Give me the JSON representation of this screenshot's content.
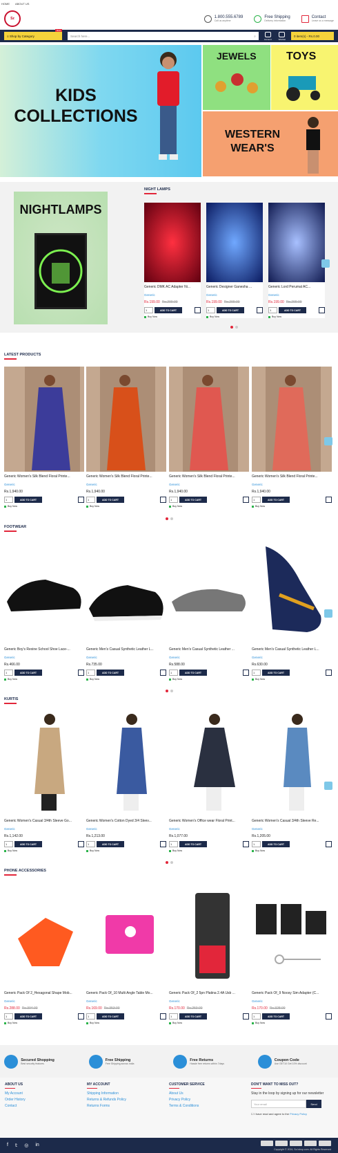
{
  "topbar": {
    "home": "HOME",
    "about": "ABOUT US"
  },
  "header": {
    "logo_text": "Sz",
    "phone": "1.800.555.6789",
    "phone_sub": "Call us anytime",
    "shipping": "Free Shipping",
    "shipping_sub": "Delivery information",
    "contact": "Contact",
    "contact_sub": "Leave us a message"
  },
  "nav": {
    "category": "Shop by Category",
    "new_tag": "New",
    "search_placeholder": "Search here...",
    "account": "Account",
    "wishlist": "Wishlist",
    "cart": "0 item(s) - Rs.0.00"
  },
  "hero": {
    "kids": "KIDS COLLECTIONS",
    "jewels": "JEWELS",
    "toys": "TOYS",
    "western": "WESTERN WEAR'S"
  },
  "nightlamps": {
    "banner": "NIGHTLAMPS",
    "title": "NIGHT LAMPS",
    "products": [
      {
        "name": "Generic DMK AC Adapter Ni...",
        "cat": "Generic",
        "price": "Rs.199.00",
        "old": "Rs.299.00"
      },
      {
        "name": "Generic Designer Ganesha ...",
        "cat": "Generic",
        "price": "Rs.199.00",
        "old": "Rs.299.00"
      },
      {
        "name": "Generic Lord Perumal AC...",
        "cat": "Generic",
        "price": "Rs.199.00",
        "old": "Rs.299.00"
      }
    ]
  },
  "common": {
    "qty": "1",
    "add": "ADD TO CART",
    "buy": "Buy Now"
  },
  "latest": {
    "title": "LATEST PRODUCTS",
    "products": [
      {
        "name": "Generic Women's Silk Blend Floral Printe...",
        "cat": "Generic",
        "price": "Rs.1,940.00"
      },
      {
        "name": "Generic Women's Silk Blend Floral Printe...",
        "cat": "Generic",
        "price": "Rs.1,940.00"
      },
      {
        "name": "Generic Women's Silk Blend Floral Printe...",
        "cat": "Generic",
        "price": "Rs.1,940.00"
      },
      {
        "name": "Generic Women's Silk Blend Floral Printe...",
        "cat": "Generic",
        "price": "Rs.1,940.00"
      }
    ]
  },
  "footwear": {
    "title": "FOOTWEAR",
    "products": [
      {
        "name": "Generic Boy's Rexine School Shoe Lace-...",
        "cat": "Generic",
        "price": "Rs.466.00"
      },
      {
        "name": "Generic Men's Casual Synthetic Leather L...",
        "cat": "Generic",
        "price": "Rs.735.00"
      },
      {
        "name": "Generic Men's Casual Synthetic Leather ...",
        "cat": "Generic",
        "price": "Rs.588.00"
      },
      {
        "name": "Generic Men's Casual Synthetic Leather L...",
        "cat": "Generic",
        "price": "Rs.630.00"
      }
    ]
  },
  "kurtis": {
    "title": "KURTIS",
    "products": [
      {
        "name": "Generic Women's Casual 3/4th Sleeve Go...",
        "cat": "Generic",
        "price": "Rs.1,142.00"
      },
      {
        "name": "Generic Women's Cotton Dyed 3/4 Sleev...",
        "cat": "Generic",
        "price": "Rs.1,213.00"
      },
      {
        "name": "Generic Women's Office wear Floral Print...",
        "cat": "Generic",
        "price": "Rs.1,077.00"
      },
      {
        "name": "Generic Women's Casual 3/4th Sleeve Re...",
        "cat": "Generic",
        "price": "Rs.1,205.00"
      }
    ]
  },
  "phone": {
    "title": "PHONE ACCESSORIES",
    "products": [
      {
        "name": "Generic Pack Of 2_Hexagonal Shape Mob...",
        "cat": "Generic",
        "price": "Rs.288.00",
        "old": "Rs.394.00"
      },
      {
        "name": "Generic Pack Of_10 Multi Angle Table Mo...",
        "cat": "Generic",
        "price": "Rs.169.00",
        "old": "Rs.353.00"
      },
      {
        "name": "Generic Pack Of_2 5pn Platina 2.4A Usb ...",
        "cat": "Generic",
        "price": "Rs.170.00",
        "old": "Rs.259.00"
      },
      {
        "name": "Generic Pack Of_9 Noosy Sim Adapter (C...",
        "cat": "Generic",
        "price": "Rs.170.00",
        "old": "Rs.328.00"
      }
    ]
  },
  "features": [
    {
      "t": "Secured Shopping",
      "s": "Best security features"
    },
    {
      "t": "Free Shipping",
      "s": "Free Shipping across India"
    },
    {
      "t": "Free Returns",
      "s": "Hassle free returns within 7days"
    },
    {
      "t": "Coupon Code",
      "s": "Use GET10 Get 10% discount"
    }
  ],
  "footer": {
    "about": {
      "title": "ABOUT US",
      "links": [
        "My Account",
        "Order History",
        "Contact"
      ]
    },
    "account": {
      "title": "MY ACCOUNT",
      "links": [
        "Shipping Information",
        "Returns & Refunds Policy",
        "Returns Forms"
      ]
    },
    "service": {
      "title": "CUSTOMER SERVICE",
      "links": [
        "About Us",
        "Privacy Policy",
        "Terms & Conditions"
      ]
    },
    "newsletter": {
      "title": "DON'T WANT TO MISS OUT?",
      "text": "Stay in the loop by signing up for our newsletter",
      "placeholder": "Your email",
      "send": "Send",
      "agree": "I have read and agree to the",
      "policy": "Privacy Policy"
    }
  },
  "bottom": {
    "copyright": "Copyright © 2024, Sz.Ishop.com. All Rights Reserved"
  }
}
